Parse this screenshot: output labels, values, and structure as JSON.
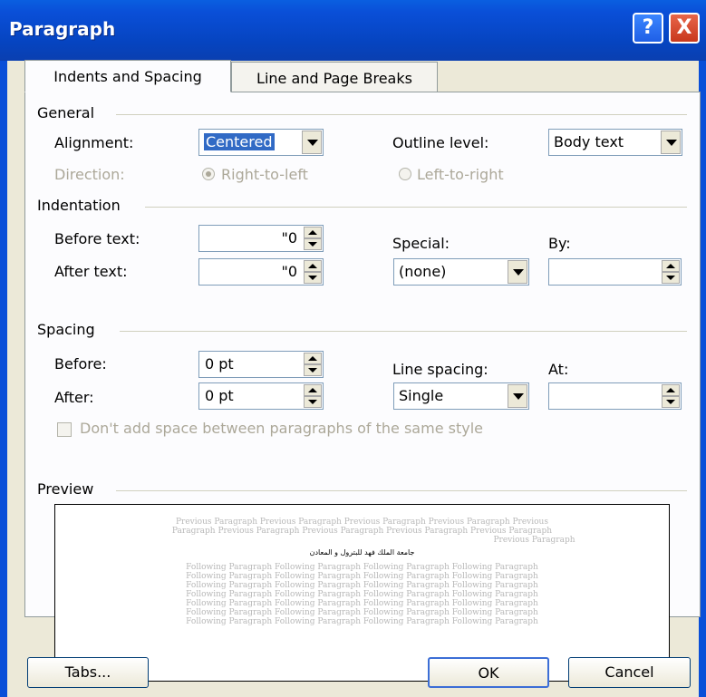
{
  "window": {
    "title": "Paragraph",
    "help_label": "?",
    "close_label": "X"
  },
  "tabs": [
    {
      "label": "Indents and Spacing",
      "active": true
    },
    {
      "label": "Line and Page Breaks",
      "active": false
    }
  ],
  "general": {
    "section_label": "General",
    "alignment_label": "Alignment:",
    "alignment_value": "Centered",
    "outline_label": "Outline level:",
    "outline_value": "Body text",
    "direction_label": "Direction:",
    "rtl_label": "Right-to-left",
    "ltr_label": "Left-to-right"
  },
  "indentation": {
    "section_label": "Indentation",
    "before_label": "Before text:",
    "before_value": "\"0",
    "after_label": "After text:",
    "after_value": "\"0",
    "special_label": "Special:",
    "special_value": "(none)",
    "by_label": "By:",
    "by_value": ""
  },
  "spacing": {
    "section_label": "Spacing",
    "before_label": "Before:",
    "before_value": "0 pt",
    "after_label": "After:",
    "after_value": "0 pt",
    "line_spacing_label": "Line spacing:",
    "line_spacing_value": "Single",
    "at_label": "At:",
    "at_value": "",
    "dont_add_label": "Don't add space between paragraphs of the same style"
  },
  "preview": {
    "section_label": "Preview",
    "previous_lines": [
      "Previous Paragraph Previous Paragraph Previous Paragraph Previous Paragraph Previous",
      "Paragraph Previous Paragraph Previous Paragraph Previous Paragraph Previous Paragraph",
      "Previous Paragraph"
    ],
    "main_text": "جامعة الملك فهد للبترول و المعادن",
    "following_lines": [
      "Following Paragraph Following Paragraph Following Paragraph Following Paragraph",
      "Following Paragraph Following Paragraph Following Paragraph Following Paragraph",
      "Following Paragraph Following Paragraph Following Paragraph Following Paragraph",
      "Following Paragraph Following Paragraph Following Paragraph Following Paragraph",
      "Following Paragraph Following Paragraph Following Paragraph Following Paragraph",
      "Following Paragraph Following Paragraph Following Paragraph Following Paragraph",
      "Following Paragraph Following Paragraph Following Paragraph Following Paragraph"
    ]
  },
  "buttons": {
    "tabs": "Tabs...",
    "ok": "OK",
    "cancel": "Cancel"
  }
}
